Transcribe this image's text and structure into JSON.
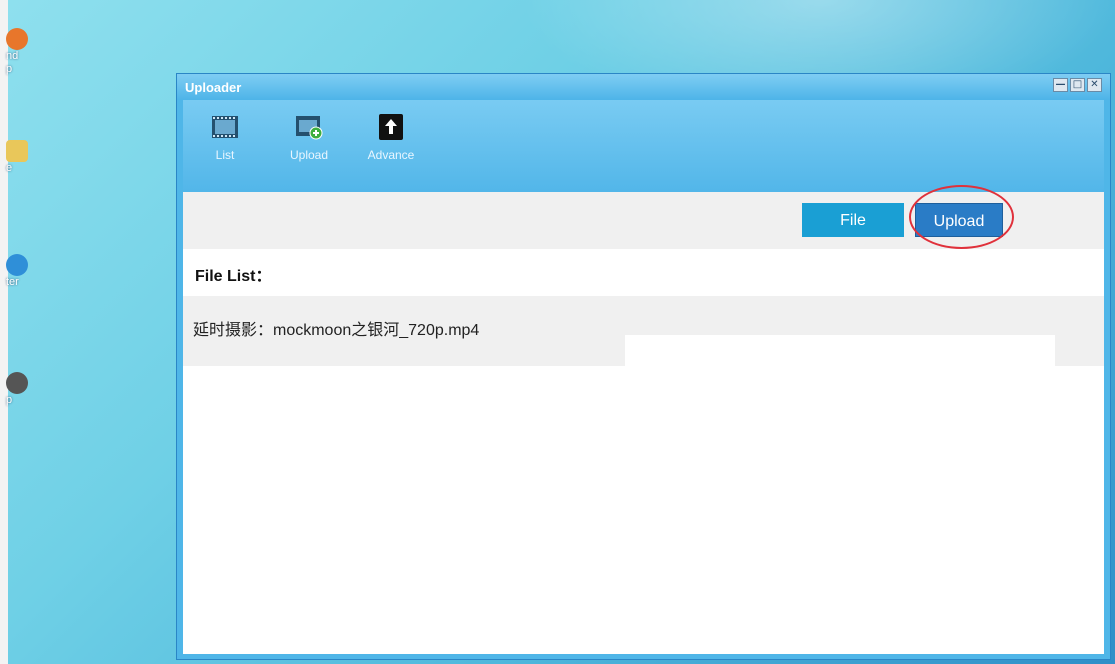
{
  "desktop": {
    "icons": [
      {
        "name": "orange-app-icon",
        "label": "nd\np",
        "color": "#e8762b"
      },
      {
        "name": "notepad-icon",
        "label": "e",
        "color": "#e9c75a"
      },
      {
        "name": "cloud-icon",
        "label": "ter",
        "color": "#2f8fd8"
      },
      {
        "name": "gear-app-icon",
        "label": "p",
        "color": "#555555"
      }
    ]
  },
  "window": {
    "title": "Uploader",
    "controls": {
      "minimize": "—",
      "maximize": "□",
      "close": "✕"
    }
  },
  "toolbar": {
    "items": [
      {
        "label": "List",
        "icon": "film-icon"
      },
      {
        "label": "Upload",
        "icon": "film-add-icon"
      },
      {
        "label": "Advance",
        "icon": "upload-arrow-icon"
      }
    ]
  },
  "actions": {
    "file_label": "File",
    "upload_label": "Upload"
  },
  "file_list": {
    "header": "File List：",
    "items": [
      "延时摄影：mockmoon之银河_720p.mp4"
    ]
  },
  "colors": {
    "accent": "#1a9fd4",
    "upload_button": "#2a7cc6",
    "highlight_circle": "#e0313b",
    "window_chrome": "#4fb6e8"
  }
}
